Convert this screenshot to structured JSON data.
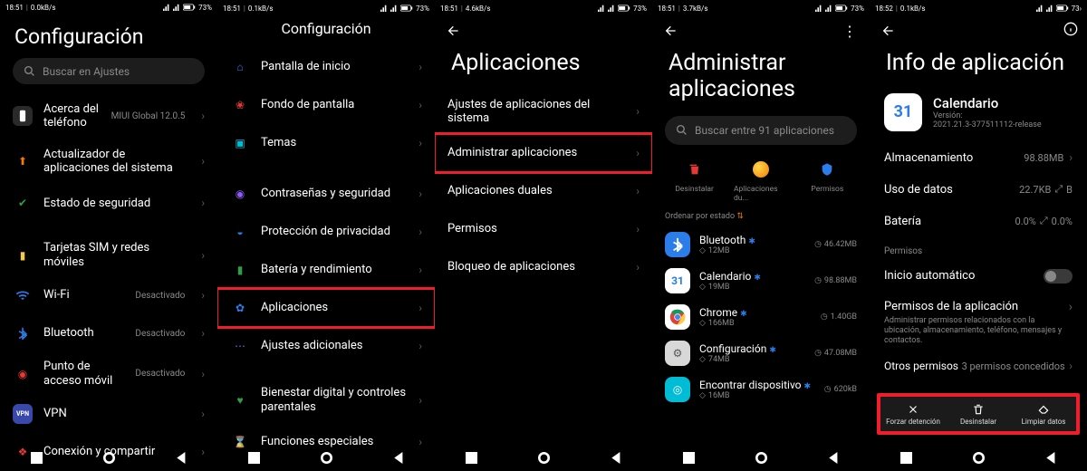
{
  "screens": {
    "s1": {
      "status": {
        "time": "18:51",
        "net": "0.0kB/s",
        "bat": "73"
      },
      "title": "Configuración",
      "search": "Buscar en Ajustes",
      "items": [
        {
          "icon": "phone",
          "color": "#3a3a3a",
          "label": "Acerca del teléfono",
          "side": "MIUI Global 12.0.5"
        },
        {
          "icon": "update",
          "color": "#f57c00",
          "label": "Actualizador de aplicaciones del sistema"
        },
        {
          "icon": "shield",
          "color": "#2ea043",
          "label": "Estado de seguridad"
        },
        {
          "gap": true
        },
        {
          "icon": "sim",
          "color": "#f2c94c",
          "label": "Tarjetas SIM y redes móviles"
        },
        {
          "icon": "wifi",
          "color": "#2b7de9",
          "label": "Wi-Fi",
          "side": "Desactivado"
        },
        {
          "icon": "bt",
          "color": "#2b7de9",
          "label": "Bluetooth",
          "side": "Desactivado"
        },
        {
          "icon": "hotspot",
          "color": "#e53935",
          "label": "Punto de acceso móvil",
          "side": "Desactivado"
        },
        {
          "icon": "vpn",
          "color": "#3949ab",
          "label": "VPN"
        },
        {
          "icon": "share",
          "color": "#e53935",
          "label": "Conexión y compartir"
        }
      ]
    },
    "s2": {
      "status": {
        "time": "18:51",
        "net": "0.1kB/s",
        "bat": "73"
      },
      "title": "Configuración",
      "items": [
        {
          "icon": "home",
          "color": "#2b7de9",
          "label": "Pantalla de inicio"
        },
        {
          "icon": "wall",
          "color": "#e53935",
          "label": "Fondo de pantalla"
        },
        {
          "icon": "theme",
          "color": "#00bcd4",
          "label": "Temas"
        },
        {
          "gap": true
        },
        {
          "icon": "lock",
          "color": "#8b5cf6",
          "label": "Contraseñas y seguridad"
        },
        {
          "icon": "privacy",
          "color": "#2b7de9",
          "label": "Protección de privacidad"
        },
        {
          "icon": "battery",
          "color": "#2ea043",
          "label": "Batería y rendimiento"
        },
        {
          "icon": "apps",
          "color": "#2b7de9",
          "label": "Aplicaciones",
          "hl": true
        },
        {
          "icon": "more",
          "color": "#8b5cf6",
          "label": "Ajustes adicionales"
        },
        {
          "gap": true
        },
        {
          "icon": "wellbeing",
          "color": "#2ea043",
          "label": "Bienestar digital y controles parentales"
        },
        {
          "icon": "special",
          "color": "#2b7de9",
          "label": "Funciones especiales"
        }
      ]
    },
    "s3": {
      "status": {
        "time": "18:51",
        "net": "4.6kB/s",
        "bat": "73"
      },
      "title": "Aplicaciones",
      "items": [
        {
          "label": "Ajustes de aplicaciones del sistema"
        },
        {
          "label": "Administrar aplicaciones",
          "hl": true
        },
        {
          "label": "Aplicaciones duales"
        },
        {
          "label": "Permisos"
        },
        {
          "label": "Bloqueo de aplicaciones"
        }
      ]
    },
    "s4": {
      "status": {
        "time": "18:51",
        "net": "3.7kB/s",
        "bat": "73"
      },
      "title": "Administrar aplicaciones",
      "search": "Buscar entre 91 aplicaciones",
      "actions": [
        {
          "icon": "trash",
          "color": "#e53935",
          "label": "Desinstalar"
        },
        {
          "icon": "dual",
          "color": "#f2c94c",
          "label": "Aplicaciones du..."
        },
        {
          "icon": "perm",
          "color": "#2b7de9",
          "label": "Permisos"
        }
      ],
      "sort": "Ordenar por estado",
      "apps": [
        {
          "name": "Bluetooth",
          "color": "#2b7de9",
          "store": "12MB",
          "total": "46.42MB"
        },
        {
          "name": "Calendario",
          "color": "#f57c00",
          "store": "19MB",
          "total": "98.88MB"
        },
        {
          "name": "Chrome",
          "color": "#fff",
          "store": "166MB",
          "total": "1.40GB"
        },
        {
          "name": "Configuración",
          "color": "#8a8a8a",
          "store": "74MB",
          "total": "47.08MB"
        },
        {
          "name": "Encontrar dispositivo",
          "color": "#00bcd4",
          "store": "16MB",
          "total": "620kB"
        }
      ]
    },
    "s5": {
      "status": {
        "time": "18:52",
        "net": "0.1kB/s",
        "bat": "73"
      },
      "title": "Info de aplicación",
      "app": {
        "name": "Calendario",
        "version_label": "Versión:",
        "version": "2021.21.3-377511112-release"
      },
      "stats": [
        {
          "k": "Almacenamiento",
          "v": "98.88MB"
        },
        {
          "k": "Uso de datos",
          "v": "22.7KB",
          "ex": "B"
        },
        {
          "k": "Batería",
          "v": "0.0%",
          "ex": "0.0%"
        }
      ],
      "perm_header": "Permisos",
      "autostart": "Inicio automático",
      "perms_title": "Permisos de la aplicación",
      "perms_desc": "Administrar permisos relacionados con la ubicación, almacenamiento, teléfono, mensajes y contactos.",
      "other": "Otros permisos",
      "other_v": "3 permisos concedidos",
      "bottom": [
        {
          "icon": "close",
          "label": "Forzar detención"
        },
        {
          "icon": "trash",
          "label": "Desinstalar"
        },
        {
          "icon": "clear",
          "label": "Limpiar datos"
        }
      ]
    }
  }
}
